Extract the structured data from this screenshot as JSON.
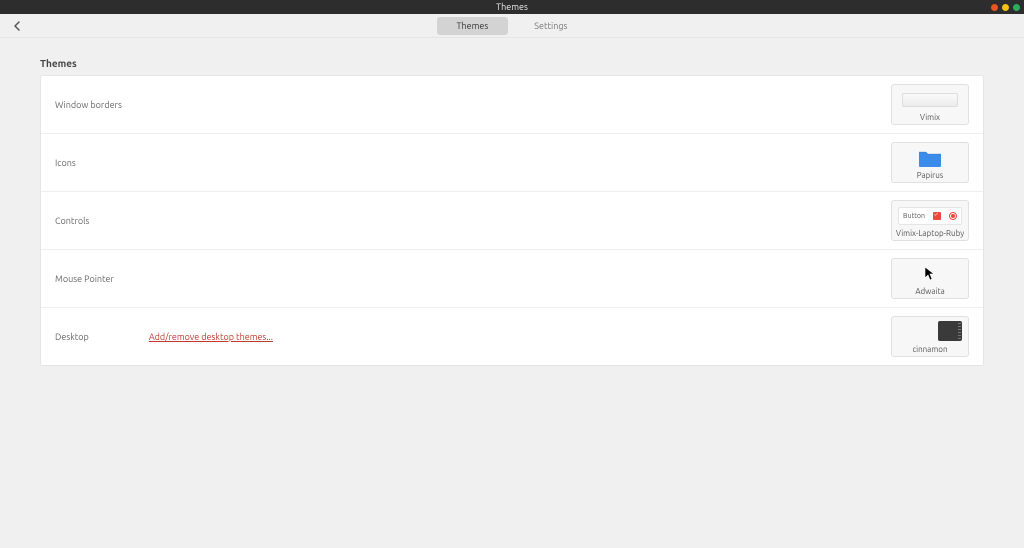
{
  "window": {
    "title": "Themes"
  },
  "tabs": {
    "themes": "Themes",
    "settings": "Settings",
    "active": "themes"
  },
  "section": {
    "title": "Themes"
  },
  "rows": {
    "window_borders": {
      "label": "Window borders",
      "value": "Vimix"
    },
    "icons": {
      "label": "Icons",
      "value": "Papirus"
    },
    "controls": {
      "label": "Controls",
      "value": "Vimix-Laptop-Ruby",
      "preview_button_text": "Button"
    },
    "mouse_pointer": {
      "label": "Mouse Pointer",
      "value": "Adwaita"
    },
    "desktop": {
      "label": "Desktop",
      "value": "cinnamon",
      "link": "Add/remove desktop themes..."
    }
  }
}
